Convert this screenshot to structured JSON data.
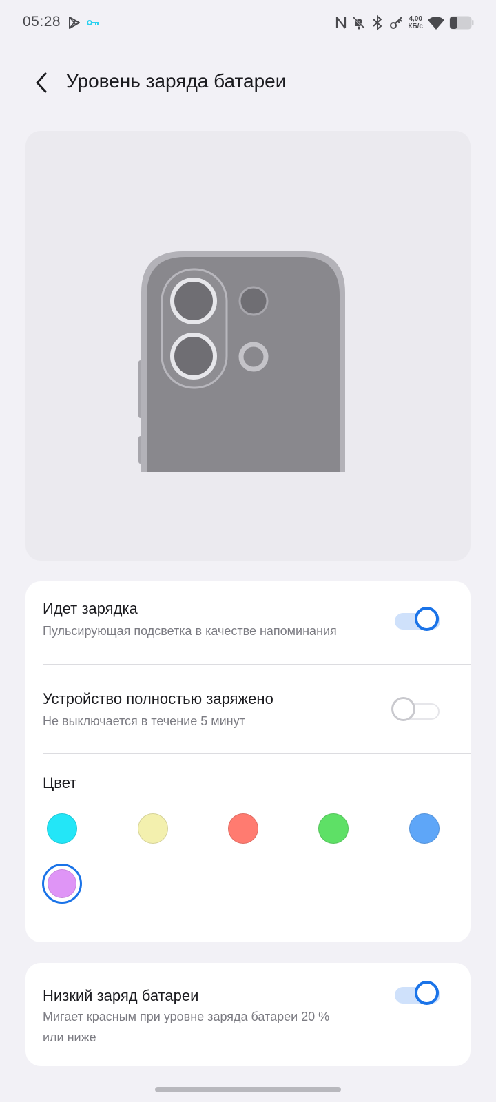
{
  "status_bar": {
    "time": "05:28",
    "left_icons": [
      "play-store-icon",
      "vpn-key-icon"
    ],
    "right_icons": [
      "nfc-icon",
      "bell-muted-icon",
      "bluetooth-icon",
      "key-icon",
      "wifi-icon",
      "battery-icon"
    ],
    "speed_value": "4,00",
    "speed_unit": "КБ/с"
  },
  "header": {
    "back_icon": "chevron-left-icon",
    "title": "Уровень заряда батареи"
  },
  "settings": {
    "charging": {
      "title": "Идет зарядка",
      "subtitle": "Пульсирующая подсветка в качестве напоминания",
      "enabled": true
    },
    "fully_charged": {
      "title": "Устройство полностью заряжено",
      "subtitle": "Не выключается в течение 5 минут",
      "enabled": false
    },
    "color": {
      "title": "Цвет",
      "swatches": [
        "#23e6f7",
        "#f3f0ae",
        "#ff7b70",
        "#5ee066",
        "#5ea6f8",
        "#df95f6"
      ],
      "selected_index": 5
    },
    "low_battery": {
      "title": "Низкий заряд батареи",
      "subtitle_line1": "Мигает красным при уровне заряда батареи 20 %",
      "subtitle_line2": "или ниже",
      "enabled": true
    }
  },
  "colors": {
    "accent": "#1a73e8",
    "background": "#f2f1f6",
    "card": "#ffffff"
  }
}
